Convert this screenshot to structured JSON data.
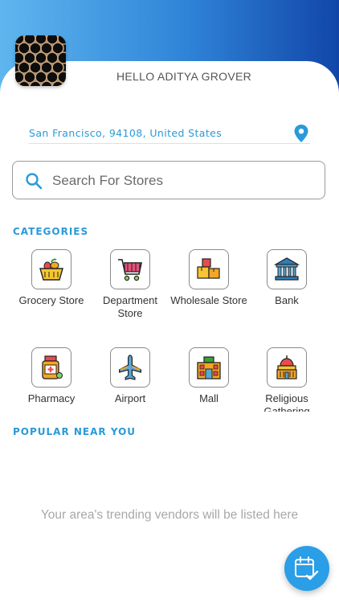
{
  "header": {
    "greeting": "HELLO ADITYA GROVER",
    "gradient_colors": [
      "#5fb6ee",
      "#1146a8"
    ]
  },
  "location": {
    "text": "San Francisco, 94108, United States",
    "icon": "location-pin-icon"
  },
  "search": {
    "placeholder": "Search For Stores",
    "value": "",
    "icon": "search-icon"
  },
  "categories": {
    "title": "CATEGORIES",
    "items": [
      {
        "label": "Grocery Store",
        "icon": "grocery-basket-icon"
      },
      {
        "label": "Department Store",
        "icon": "shopping-cart-icon"
      },
      {
        "label": "Wholesale Store",
        "icon": "boxes-icon"
      },
      {
        "label": "Bank",
        "icon": "bank-icon"
      },
      {
        "label": "Pharmacy",
        "icon": "medicine-bottle-icon"
      },
      {
        "label": "Airport",
        "icon": "airplane-icon"
      },
      {
        "label": "Mall",
        "icon": "mall-building-icon"
      },
      {
        "label": "Religious Gathering",
        "icon": "religious-building-icon"
      }
    ]
  },
  "popular": {
    "title": "POPULAR NEAR YOU",
    "empty_message": "Your area's trending vendors will be listed here"
  },
  "fab": {
    "icon": "calendar-check-icon"
  },
  "accent_color": "#2a9ad8"
}
